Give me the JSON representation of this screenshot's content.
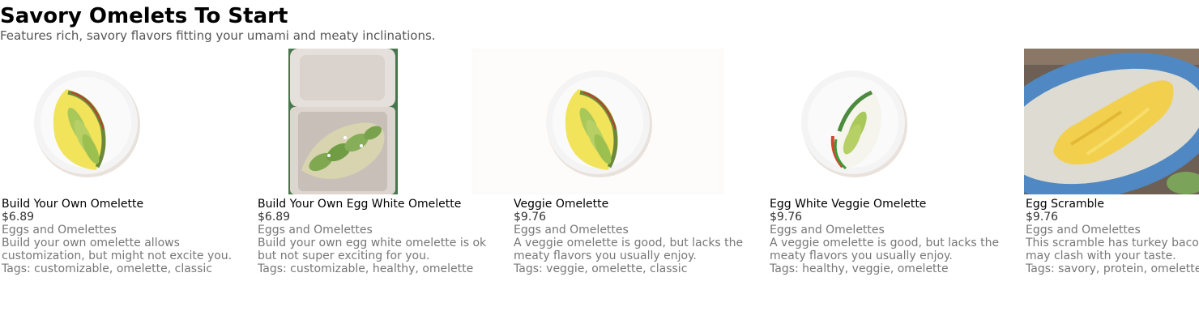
{
  "section": {
    "title": "Savory Omelets To Start",
    "subtitle": "Features rich, savory flavors fitting your umami and meaty inclinations."
  },
  "items": [
    {
      "name": "Build Your Own Omelette",
      "price": "$6.89",
      "category": "Eggs and Omelettes",
      "description": "Build your own omelette allows customization, but might not excite you.",
      "tags": "Tags: customizable, omelette, classic",
      "image": "omelette-plate-photo"
    },
    {
      "name": "Build Your Own Egg White Omelette",
      "price": "$6.89",
      "category": "Eggs and Omelettes",
      "description": "Build your own egg white omelette is ok but not super exciting for you.",
      "tags": "Tags: customizable, healthy, omelette",
      "image": "takeout-box-omelette-photo"
    },
    {
      "name": "Veggie Omelette",
      "price": "$9.76",
      "category": "Eggs and Omelettes",
      "description": "A veggie omelette is good, but lacks the meaty flavors you usually enjoy.",
      "tags": "Tags: veggie, omelette, classic",
      "image": "omelette-plate-photo"
    },
    {
      "name": "Egg White Veggie Omelette",
      "price": "$9.76",
      "category": "Eggs and Omelettes",
      "description": "A veggie omelette is good, but lacks the meaty flavors you usually enjoy.",
      "tags": "Tags: healthy, veggie, omelette",
      "image": "egg-white-omelette-plate-photo"
    },
    {
      "name": "Egg Scramble",
      "price": "$9.76",
      "category": "Eggs and Omelettes",
      "description": "This scramble has turkey bacon and feta may clash with your taste.",
      "tags": "Tags: savory, protein, omelette",
      "image": "scramble-platter-photo"
    }
  ]
}
